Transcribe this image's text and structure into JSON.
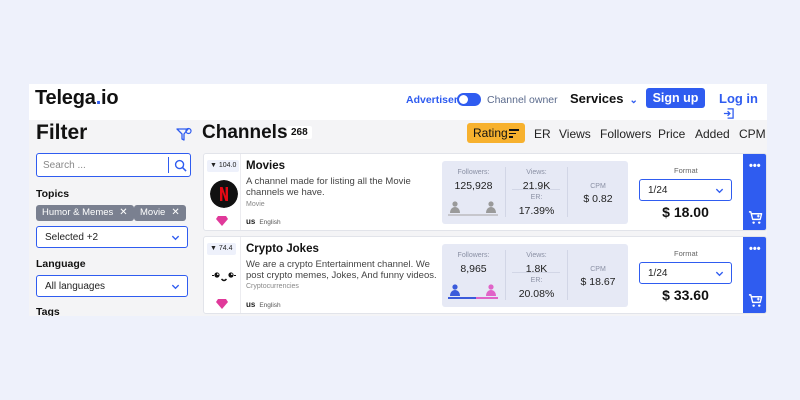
{
  "header": {
    "logo_main": "Telega",
    "logo_dot": ".",
    "logo_tld": "io",
    "role_advertiser": "Advertiser",
    "role_owner": "Channel owner",
    "services_label": "Services",
    "signup_label": "Sign up",
    "login_label": "Log in"
  },
  "sidebar": {
    "title": "Filter",
    "search_placeholder": "Search ...",
    "topics_label": "Topics",
    "chips": [
      "Humor & Memes",
      "Movie"
    ],
    "topics_select_value": "Selected +2",
    "language_label": "Language",
    "language_value": "All languages",
    "tags_label": "Tags"
  },
  "main": {
    "title": "Channels",
    "count": "268",
    "sort_options": [
      "Rating",
      "ER",
      "Views",
      "Followers",
      "Price",
      "Added",
      "CPM"
    ],
    "format_label": "Format"
  },
  "channels": [
    {
      "rating": "104.0",
      "name": "Movies",
      "description": "A channel made for listing all the Movie channels we have.",
      "category": "Movie",
      "country": "us",
      "language": "English",
      "followers_label": "Followers:",
      "followers": "125,928",
      "views_label": "Views:",
      "views": "21.9K",
      "er_label": "ER:",
      "er": "17.39%",
      "cpm_label": "CPM",
      "cpm": "$ 0.82",
      "format": "1/24",
      "price": "$ 18.00",
      "avatar_icon": "netflix-logo",
      "male_share": 0.5,
      "female_share": 0.5
    },
    {
      "rating": "74.4",
      "name": "Crypto Jokes",
      "description": "We are a crypto Entertainment channel. We post crypto memes, Jokes, And funny videos.",
      "category": "Cryptocurrencies",
      "country": "us",
      "language": "English",
      "followers_label": "Followers:",
      "followers": "8,965",
      "views_label": "Views:",
      "views": "1.8K",
      "er_label": "ER:",
      "er": "20.08%",
      "cpm_label": "CPM",
      "cpm": "$ 18.67",
      "format": "1/24",
      "price": "$ 33.60",
      "avatar_icon": "kawaii-face",
      "male_share": 0.55,
      "female_share": 0.45
    }
  ],
  "colors": {
    "accent": "#2f5cf0",
    "rating_sort": "#f7b12e",
    "chip": "#7a8090",
    "male": "#3b5bdb",
    "female": "#e064c8",
    "gem": "#e0399a"
  }
}
